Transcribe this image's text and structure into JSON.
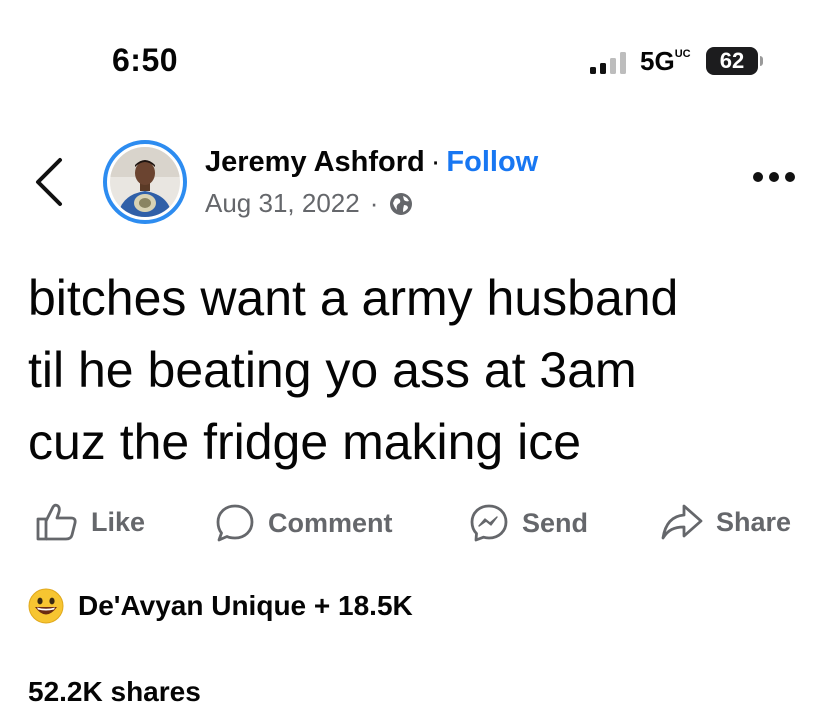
{
  "status_bar": {
    "time": "6:50",
    "network": "5G",
    "network_badge": "UC",
    "battery": "62"
  },
  "post": {
    "author": "Jeremy Ashford",
    "separator": "·",
    "follow_label": "Follow",
    "date": "Aug 31, 2022",
    "privacy_icon": "globe-icon",
    "text_lines": [
      "bitches want a army husband",
      "til he beating yo ass at 3am",
      "cuz the fridge making ice"
    ]
  },
  "actions": {
    "like": "Like",
    "comment": "Comment",
    "send": "Send",
    "share": "Share"
  },
  "reactions": {
    "icon": "grinning-face-emoji",
    "summary": "De'Avyan Unique + 18.5K"
  },
  "shares": "52.2K shares",
  "colors": {
    "accent": "#1877f2",
    "secondary_text": "#65676b",
    "avatar_ring": "#2d8cf0"
  }
}
